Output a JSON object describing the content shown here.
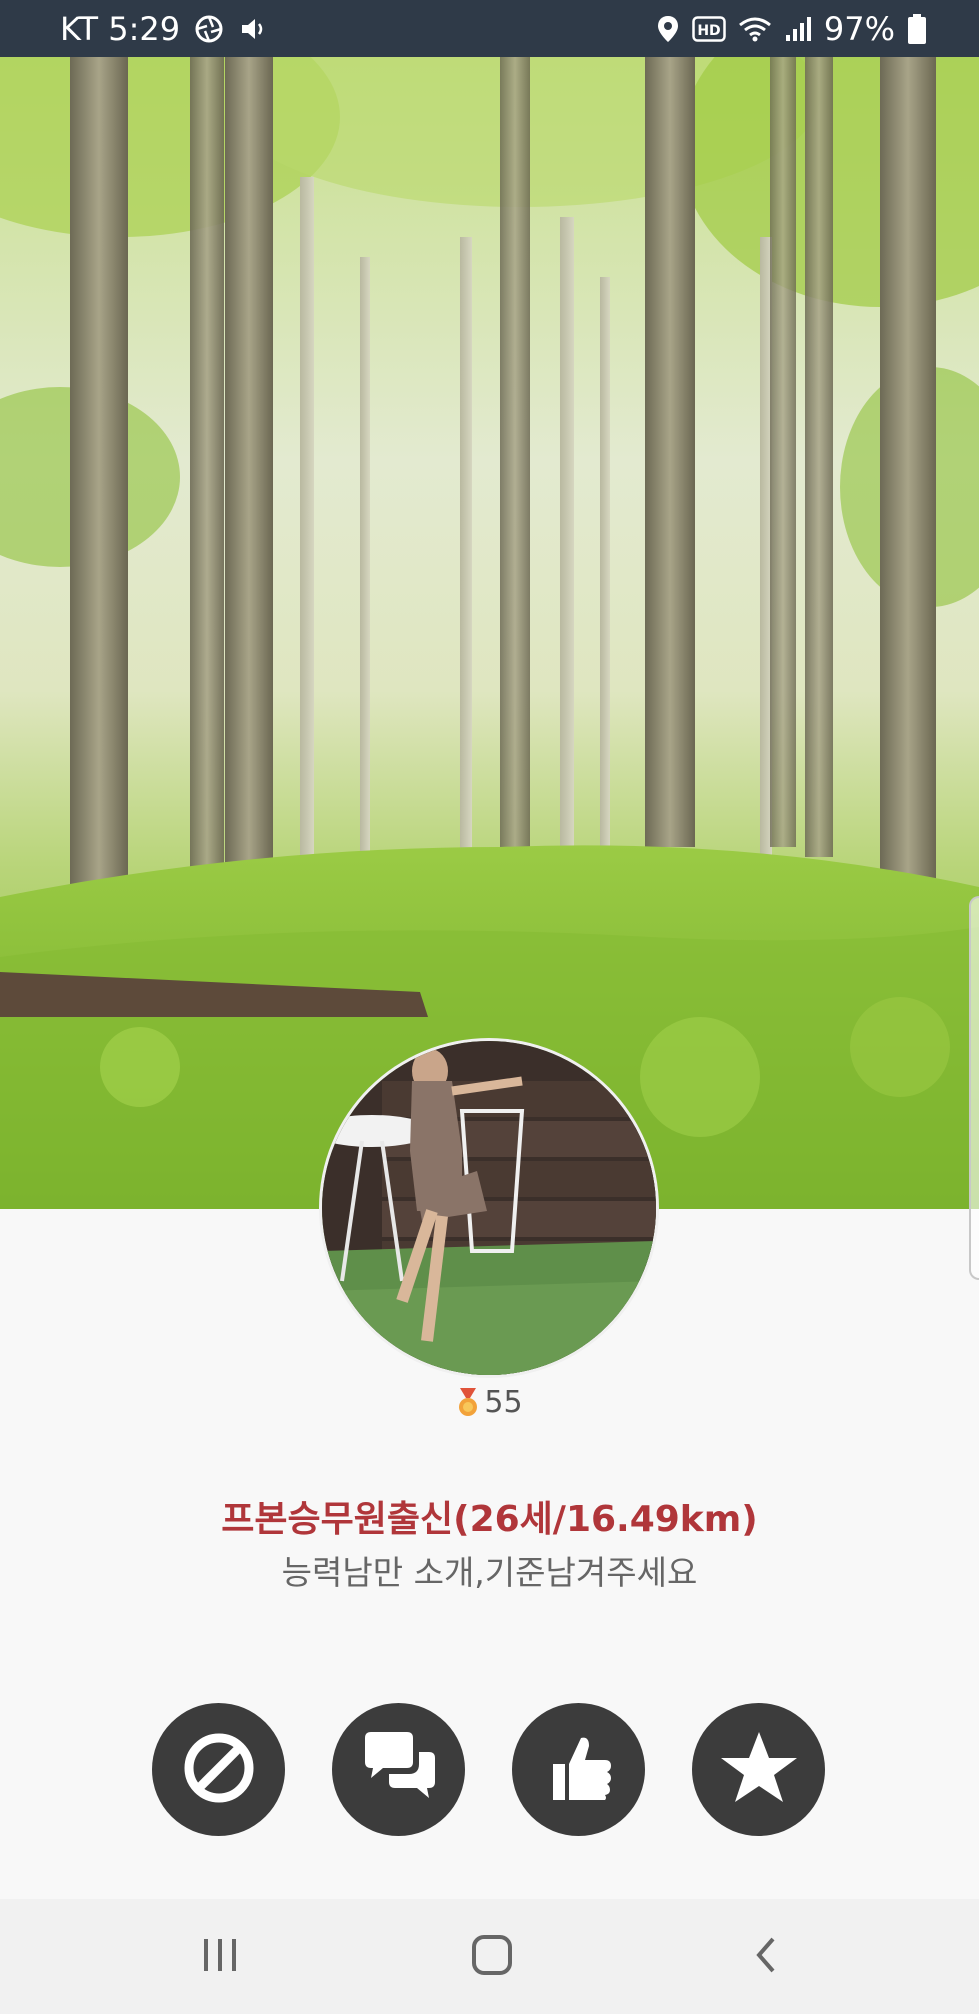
{
  "status_bar": {
    "carrier_time": "KT 5:29",
    "battery": "97%",
    "icons": [
      "aperture-icon",
      "volume-icon",
      "location-icon",
      "hd-icon",
      "wifi-icon",
      "signal-icon",
      "battery-icon"
    ]
  },
  "profile": {
    "score": "55",
    "score_icon": "medal-icon",
    "name_line": "프본승무원출신(26세/16.49km)",
    "intro": "능력남만 소개,기준남겨주세요"
  },
  "actions": [
    {
      "name": "block-button",
      "icon": "block-icon"
    },
    {
      "name": "chat-button",
      "icon": "chat-bubbles-icon"
    },
    {
      "name": "like-button",
      "icon": "thumbs-up-icon"
    },
    {
      "name": "favorite-button",
      "icon": "star-icon"
    }
  ],
  "nav": [
    "recent-apps-icon",
    "home-icon",
    "back-icon"
  ],
  "colors": {
    "status_bar": "#2f3a48",
    "name_text": "#b0363a",
    "intro_text": "#666666",
    "action_button": "#3c3c3c",
    "page_bg": "#f8f8f8"
  }
}
